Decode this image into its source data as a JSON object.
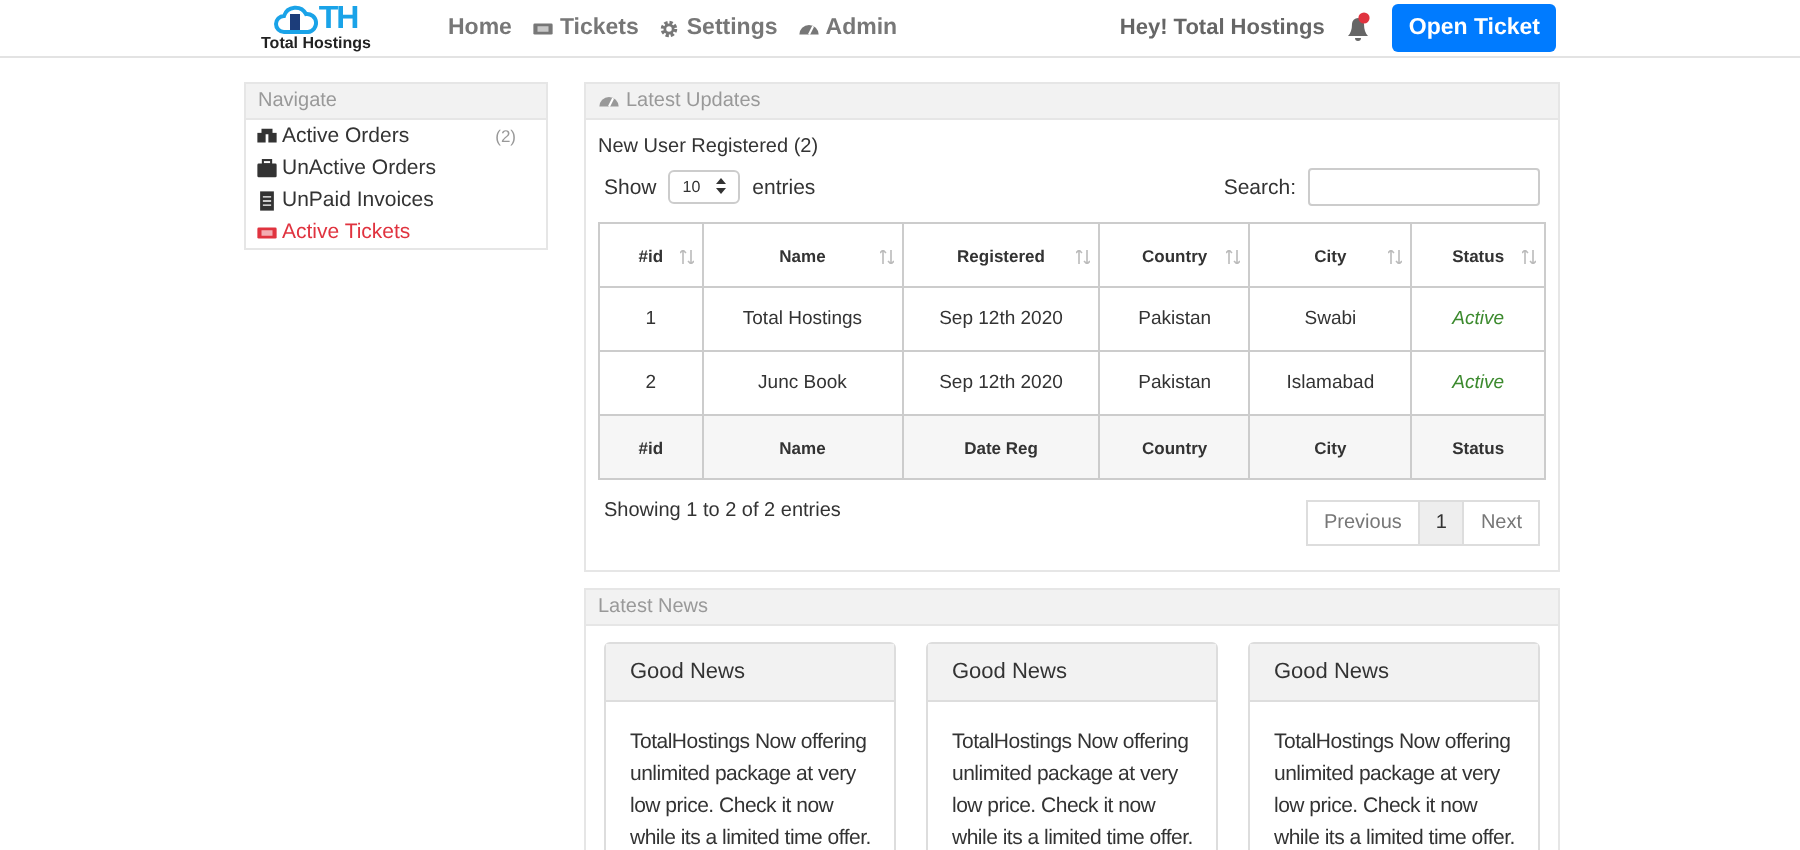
{
  "navbar": {
    "logo": {
      "mark": "TH",
      "name": "Total Hostings"
    },
    "links": [
      {
        "label": "Home"
      },
      {
        "label": "Tickets"
      },
      {
        "label": "Settings"
      },
      {
        "label": "Admin"
      }
    ],
    "greeting": "Hey! Total Hostings",
    "notification": true,
    "button": "Open Ticket"
  },
  "sidebar": {
    "title": "Navigate",
    "items": [
      {
        "label": "Active Orders",
        "count": "(2)",
        "selected": false
      },
      {
        "label": "UnActive Orders",
        "selected": false
      },
      {
        "label": "UnPaid Invoices",
        "selected": false
      },
      {
        "label": "Active Tickets",
        "selected": true
      }
    ]
  },
  "updates": {
    "title": "Latest Updates",
    "subtitle": "New User Registered (2)",
    "show_label": "Show",
    "page_size": "10",
    "entries_label": "entries",
    "search_label": "Search:",
    "table": {
      "columns": [
        "#id",
        "Name",
        "Registered",
        "Country",
        "City",
        "Status"
      ],
      "rows": [
        [
          "1",
          "Total Hostings",
          "Sep 12th 2020",
          "Pakistan",
          "Swabi",
          "Active"
        ],
        [
          "2",
          "Junc Book",
          "Sep 12th 2020",
          "Pakistan",
          "Islamabad",
          "Active"
        ]
      ],
      "footer": [
        "#id",
        "Name",
        "Date Reg",
        "Country",
        "City",
        "Status"
      ]
    },
    "info": "Showing 1 to 2 of 2 entries",
    "pagination": [
      {
        "label": "Previous",
        "selected": false
      },
      {
        "label": "1",
        "selected": true
      },
      {
        "label": "Next",
        "selected": false
      }
    ]
  },
  "news": {
    "title": "Latest News",
    "cards": [
      {
        "title": "Good News",
        "body": "TotalHostings Now offering unlimited package at very low price. Check it now while its a limited time offer."
      },
      {
        "title": "Good News",
        "body": "TotalHostings Now offering unlimited package at very low price. Check it now while its a limited time offer."
      },
      {
        "title": "Good News",
        "body": "TotalHostings Now offering unlimited package at very low price. Check it now while its a limited time offer."
      }
    ]
  }
}
